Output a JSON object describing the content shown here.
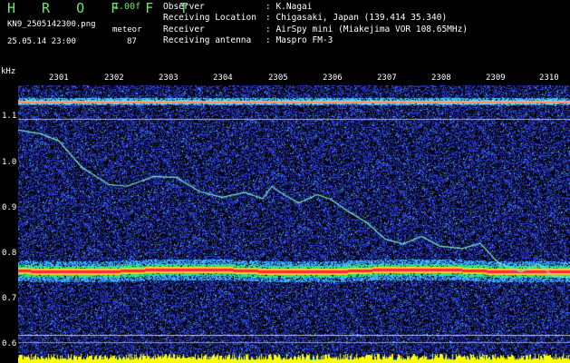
{
  "header": {
    "app_title": "H R O F F T",
    "version": "1.00f",
    "filename": "KN9_2505142300.png",
    "meteor_label": "meteor",
    "datetime": "25.05.14 23:00",
    "meteor_count": "87"
  },
  "metadata": [
    {
      "key": "Observer",
      "value": ": K.Nagai"
    },
    {
      "key": "Receiving Location",
      "value": ": Chigasaki, Japan (139.414 35.340)"
    },
    {
      "key": "Receiver",
      "value": ": AirSpy mini (Miakejima VOR 108.65MHz)"
    },
    {
      "key": "Receiving antenna",
      "value": ": Maspro FM-3"
    }
  ],
  "axis": {
    "y_unit": "kHz",
    "y_ticks": [
      "1.1",
      "1.0",
      "0.9",
      "0.8",
      "0.7",
      "0.6"
    ],
    "x_ticks": [
      "2301",
      "2302",
      "2303",
      "2304",
      "2305",
      "2306",
      "2307",
      "2308",
      "2309",
      "2310"
    ]
  },
  "colors": {
    "background": "#000000",
    "noise": "#1a2cc8",
    "trace": "#7fe6c8",
    "band_core": "#ff3030",
    "band_edge": "#ffff40",
    "band_outer": "#40d0ff",
    "floor_yellow": "#ffff00",
    "floor_cyan": "#00e0ff"
  }
}
